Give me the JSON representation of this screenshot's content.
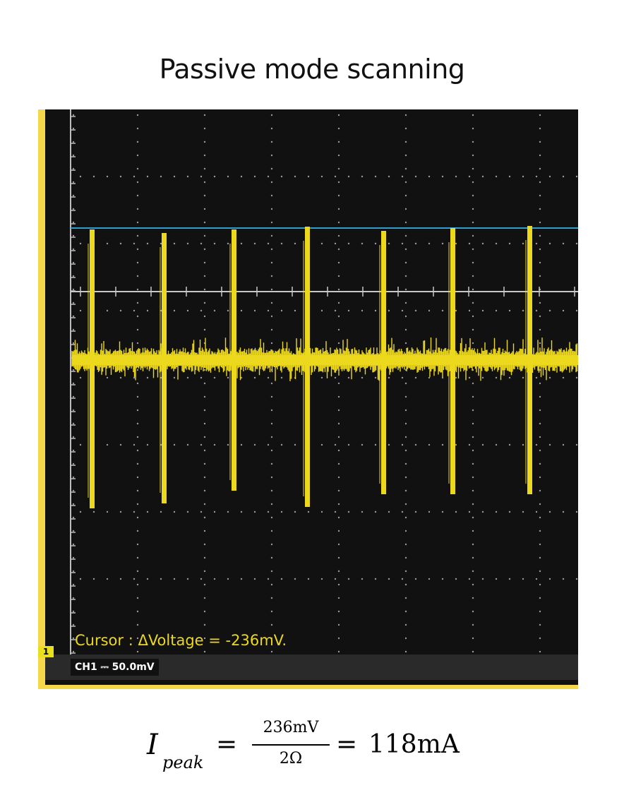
{
  "title": "Passive mode scanning",
  "scope": {
    "cursor_readout": "Cursor : ΔVoltage = -236mV.",
    "channel_marker": "1",
    "channel_label": "CH1 ⎓ 50.0mV",
    "colors": {
      "screen_background": "#111111",
      "frame": "#f5d74a",
      "trace": "#ecd81c",
      "cursor_line": "#2f9fd0",
      "reference_line": "#c8c8c8",
      "grid_dots": "#9a9a9a"
    },
    "icon_names": [
      "channel-1-ground-marker-icon"
    ]
  },
  "formula": {
    "lhs": "I",
    "lhs_subscript": "peak",
    "equals": "=",
    "numerator": "236mV",
    "denominator": "2Ω",
    "result": "118mA"
  }
}
